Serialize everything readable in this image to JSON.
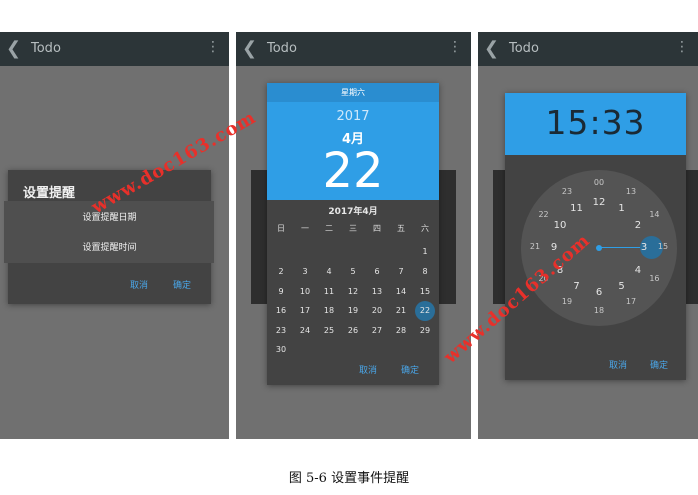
{
  "app": {
    "title": "Todo",
    "back_glyph": "❮",
    "menu_glyph": "⋮"
  },
  "panel1": {
    "dialog_title": "设置提醒",
    "options": [
      "设置提醒日期",
      "设置提醒时间"
    ],
    "cancel": "取消",
    "ok": "确定"
  },
  "panel2": {
    "weekday": "星期六",
    "year": "2017",
    "month": "4月",
    "day": "22",
    "month_label": "2017年4月",
    "weekday_heads": [
      "日",
      "一",
      "二",
      "三",
      "四",
      "五",
      "六"
    ],
    "weeks": [
      [
        "",
        "",
        "",
        "",
        "",
        "",
        "1"
      ],
      [
        "2",
        "3",
        "4",
        "5",
        "6",
        "7",
        "8"
      ],
      [
        "9",
        "10",
        "11",
        "12",
        "13",
        "14",
        "15"
      ],
      [
        "16",
        "17",
        "18",
        "19",
        "20",
        "21",
        "22"
      ],
      [
        "23",
        "24",
        "25",
        "26",
        "27",
        "28",
        "29"
      ],
      [
        "30",
        "",
        "",
        "",
        "",
        "",
        ""
      ]
    ],
    "selected": "22",
    "cancel": "取消",
    "ok": "确定"
  },
  "panel3": {
    "hour": "15",
    "separator": ":",
    "minute": "33",
    "outer_hours": [
      "12",
      "1",
      "2",
      "3",
      "4",
      "5",
      "6",
      "7",
      "8",
      "9",
      "10",
      "11"
    ],
    "inner_hours": [
      "00",
      "13",
      "14",
      "15",
      "16",
      "17",
      "18",
      "19",
      "20",
      "21",
      "22",
      "23"
    ],
    "selected_hour": "15",
    "cancel": "取消",
    "ok": "确定"
  },
  "watermark": "www.doc163.com",
  "caption": "图 5-6  设置事件提醒",
  "colors": {
    "accent": "#2f9ee6",
    "dialog": "#434343",
    "appbar": "#2c3538",
    "button_text": "#4aa6e8",
    "watermark": "#e8302a"
  }
}
